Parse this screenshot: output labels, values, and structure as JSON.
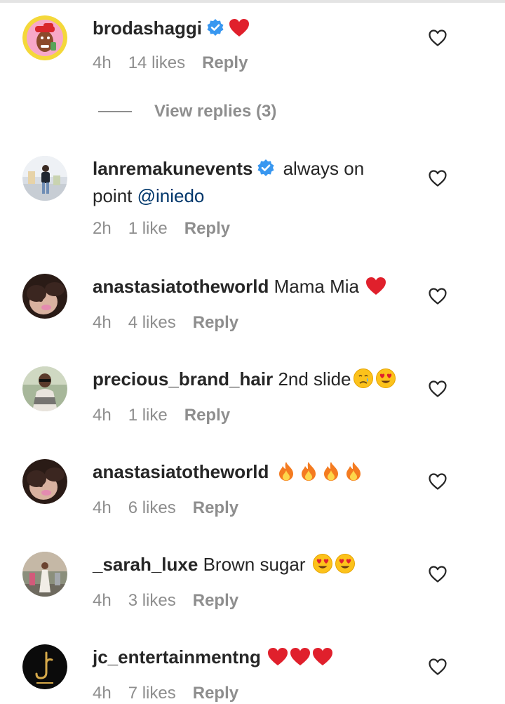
{
  "colors": {
    "text": "#262626",
    "muted": "#8e8e8e",
    "mention": "#00376b",
    "verified": "#3897f0",
    "heart_emoji": "#e0202c",
    "fire": "#f47b20"
  },
  "comments": [
    {
      "username": "brodashaggi",
      "verified": true,
      "text": "",
      "emoji": [
        "red-heart-emoji"
      ],
      "time": "4h",
      "likes": "14 likes",
      "reply_label": "Reply",
      "view_replies": "View replies (3)"
    },
    {
      "username": "lanremakunevents",
      "verified": true,
      "text": "always on",
      "text_line2_prefix": "point ",
      "mention": "@iniedo",
      "time": "2h",
      "likes": "1 like",
      "reply_label": "Reply"
    },
    {
      "username": "anastasiatotheworld",
      "verified": false,
      "text": "Mama Mia",
      "emoji": [
        "red-heart-emoji"
      ],
      "time": "4h",
      "likes": "4 likes",
      "reply_label": "Reply"
    },
    {
      "username": "precious_brand_hair",
      "verified": false,
      "text": "2nd slide",
      "emoji": [
        "crying-face-emoji",
        "heart-eyes-emoji"
      ],
      "time": "4h",
      "likes": "1 like",
      "reply_label": "Reply"
    },
    {
      "username": "anastasiatotheworld",
      "verified": false,
      "text": "",
      "emoji": [
        "fire-emoji",
        "fire-emoji",
        "fire-emoji",
        "fire-emoji"
      ],
      "time": "4h",
      "likes": "6 likes",
      "reply_label": "Reply"
    },
    {
      "username": "_sarah_luxe",
      "verified": false,
      "text": "Brown sugar",
      "emoji": [
        "heart-eyes-emoji",
        "heart-eyes-emoji"
      ],
      "time": "4h",
      "likes": "3 likes",
      "reply_label": "Reply"
    },
    {
      "username": "jc_entertainmentng",
      "verified": false,
      "text": "",
      "emoji": [
        "red-heart-emoji",
        "red-heart-emoji",
        "red-heart-emoji"
      ],
      "time": "4h",
      "likes": "7 likes",
      "reply_label": "Reply"
    }
  ]
}
